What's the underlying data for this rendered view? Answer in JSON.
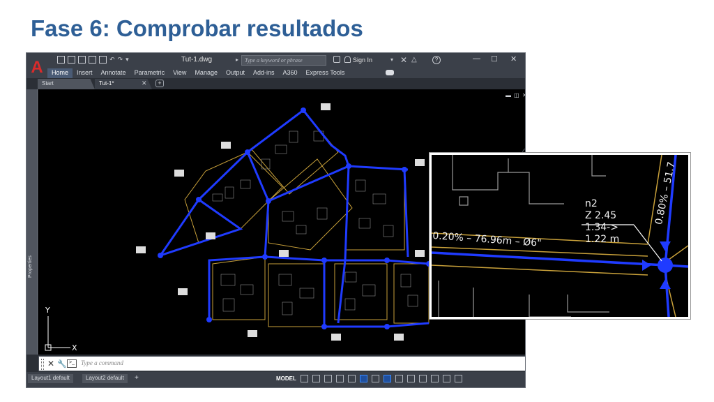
{
  "slide": {
    "title": "Fase 6: Comprobar resultados"
  },
  "autocad": {
    "app_letter": "A",
    "document_title": "Tut-1.dwg",
    "search_placeholder": "Type a keyword or phrase",
    "sign_in": "Sign In",
    "help": "?",
    "ribbon_tabs": [
      "Home",
      "Insert",
      "Annotate",
      "Parametric",
      "View",
      "Manage",
      "Output",
      "Add-ins",
      "A360",
      "Express Tools"
    ],
    "active_ribbon_tab": "Home",
    "file_tabs": [
      "Start",
      "Tut-1*"
    ],
    "active_file_tab": "Tut-1*",
    "side_panel_label": "Properties",
    "command_placeholder": "Type a command",
    "layout_tabs": [
      "Layout1 default",
      "Layout2 default"
    ],
    "space": "MODEL",
    "ucs": {
      "y_label": "Y",
      "x_label": "X"
    }
  },
  "inset": {
    "pipe_label": "0.20% – 76.96m – Ø6\"",
    "vertical_label": "0.80% – 51.7",
    "node": {
      "name": "n2",
      "elevation": "Z 2.45",
      "flow": "1.34->",
      "depth": "1.22 m"
    }
  },
  "colors": {
    "title": "#2e5f96",
    "pipe": "#1f3bff",
    "parcel": "#c9a13a",
    "lines": "#9a9a9a"
  }
}
